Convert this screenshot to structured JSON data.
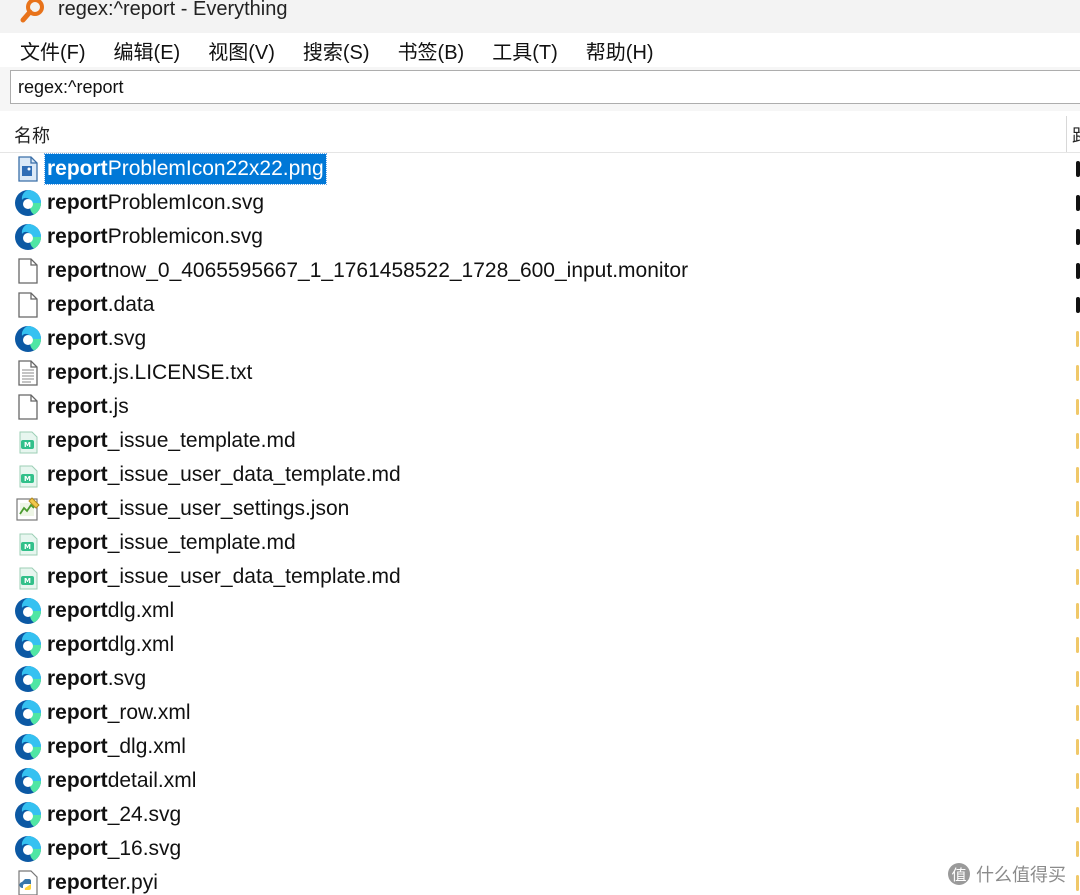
{
  "window": {
    "title": "regex:^report - Everything",
    "app_icon": "magnifier-icon"
  },
  "menu": [
    "文件(F)",
    "编辑(E)",
    "视图(V)",
    "搜索(S)",
    "书签(B)",
    "工具(T)",
    "帮助(H)"
  ],
  "search": {
    "value": "regex:^report"
  },
  "columns": {
    "name": "名称",
    "path": "路"
  },
  "files": [
    {
      "match": "report",
      "rest": "ProblemIcon22x22.png",
      "icon": "png-image-icon",
      "selected": true,
      "mark": "dark"
    },
    {
      "match": "report",
      "rest": "ProblemIcon.svg",
      "icon": "edge-icon",
      "mark": "dark"
    },
    {
      "match": "report",
      "rest": "Problemicon.svg",
      "icon": "edge-icon",
      "mark": "dark"
    },
    {
      "match": "report",
      "rest": "now_0_4065595667_1_1761458522_1728_600_input.monitor",
      "icon": "blank-file-icon",
      "mark": "dark"
    },
    {
      "match": "report",
      "rest": ".data",
      "icon": "blank-file-icon",
      "mark": "dark"
    },
    {
      "match": "report",
      "rest": ".svg",
      "icon": "edge-icon",
      "mark": "light"
    },
    {
      "match": "report",
      "rest": ".js.LICENSE.txt",
      "icon": "text-file-icon",
      "mark": "light"
    },
    {
      "match": "report",
      "rest": ".js",
      "icon": "blank-file-icon",
      "mark": "light"
    },
    {
      "match": "report",
      "rest": "_issue_template.md",
      "icon": "markdown-file-icon",
      "mark": "light"
    },
    {
      "match": "report",
      "rest": "_issue_user_data_template.md",
      "icon": "markdown-file-icon",
      "mark": "light"
    },
    {
      "match": "report",
      "rest": "_issue_user_settings.json",
      "icon": "json-file-icon",
      "mark": "light"
    },
    {
      "match": "report",
      "rest": "_issue_template.md",
      "icon": "markdown-file-icon",
      "mark": "light"
    },
    {
      "match": "report",
      "rest": "_issue_user_data_template.md",
      "icon": "markdown-file-icon",
      "mark": "light"
    },
    {
      "match": "report",
      "rest": "dlg.xml",
      "icon": "edge-icon",
      "mark": "light"
    },
    {
      "match": "report",
      "rest": "dlg.xml",
      "icon": "edge-icon",
      "mark": "light"
    },
    {
      "match": "report",
      "rest": ".svg",
      "icon": "edge-icon",
      "mark": "light"
    },
    {
      "match": "report",
      "rest": "_row.xml",
      "icon": "edge-icon",
      "mark": "light"
    },
    {
      "match": "report",
      "rest": "_dlg.xml",
      "icon": "edge-icon",
      "mark": "light"
    },
    {
      "match": "report",
      "rest": "detail.xml",
      "icon": "edge-icon",
      "mark": "light"
    },
    {
      "match": "report",
      "rest": "_24.svg",
      "icon": "edge-icon",
      "mark": "light"
    },
    {
      "match": "report",
      "rest": "_16.svg",
      "icon": "edge-icon",
      "mark": "light"
    },
    {
      "match": "report",
      "rest": "er.pyi",
      "icon": "python-file-icon",
      "mark": "light"
    }
  ],
  "watermark": {
    "badge": "值",
    "text": "什么值得买"
  },
  "colors": {
    "selection": "#0078d7",
    "edge_blue": "#0c59a4",
    "edge_teal": "#35c1f1",
    "edge_green": "#50e6a4"
  }
}
